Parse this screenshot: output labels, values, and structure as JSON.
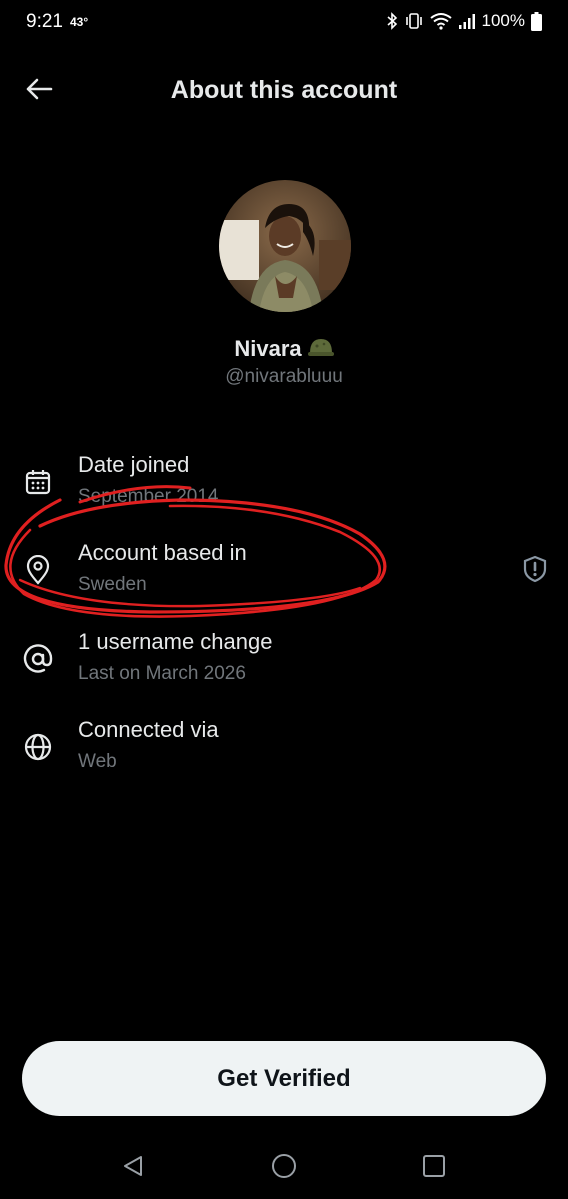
{
  "status_bar": {
    "time": "9:21",
    "temperature": "43°",
    "battery": "100%"
  },
  "header": {
    "title": "About this account",
    "back_icon": "arrow-left-icon"
  },
  "profile": {
    "name": "Nivara",
    "name_emoji": "🪖",
    "handle": "@nivarabluuu"
  },
  "info": [
    {
      "icon": "calendar-icon",
      "label": "Date joined",
      "value": "September 2014"
    },
    {
      "icon": "location-pin-icon",
      "label": "Account based in",
      "value": "Sweden",
      "badge": "shield-alert-icon"
    },
    {
      "icon": "at-sign-icon",
      "label": "1 username change",
      "value": "Last on March 2026"
    },
    {
      "icon": "globe-icon",
      "label": "Connected via",
      "value": "Web"
    }
  ],
  "cta": {
    "label": "Get Verified"
  },
  "colors": {
    "background": "#000000",
    "primary_text": "#e7e9ea",
    "secondary_text": "#71767b",
    "button_bg": "#eff3f4",
    "annotation": "#e02020"
  },
  "nav": {
    "icons": [
      "back-triangle-icon",
      "home-circle-icon",
      "recents-square-icon"
    ]
  }
}
